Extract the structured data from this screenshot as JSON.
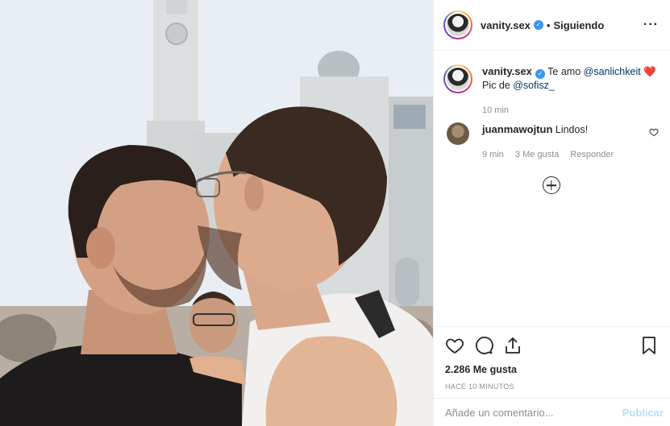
{
  "post": {
    "photo_alt": "",
    "author": {
      "username": "vanity.sex",
      "verified_icon": "verified-badge-icon",
      "follow_state": "Siguiendo",
      "separator": "•"
    },
    "more_icon": "more-options-icon"
  },
  "comments": [
    {
      "username": "vanity.sex",
      "text_before": "Te amo",
      "mention1": "@sanlichkeit",
      "emoji": "❤️",
      "line2_prefix": "Pic de",
      "mention2": "@sofisz_",
      "time": "10 min"
    },
    {
      "username": "juanmawojtun",
      "text": "Lindos!",
      "time": "9 min",
      "likes": "3 Me gusta",
      "reply": "Responder"
    }
  ],
  "actions": {
    "icons": [
      "heart-icon",
      "comment-icon",
      "share-icon",
      "bookmark-icon"
    ],
    "likes_count": "2.286 Me gusta",
    "timestamp": "HACE 10 MINUTOS"
  },
  "add_comment": {
    "placeholder": "Añade un comentario...",
    "publish_label": "Publicar"
  },
  "colors": {
    "link": "#003569",
    "verified": "#3897f0",
    "publish_disabled": "#b2dffc",
    "muted": "#8e8e8e",
    "heart": "#ed4956"
  }
}
